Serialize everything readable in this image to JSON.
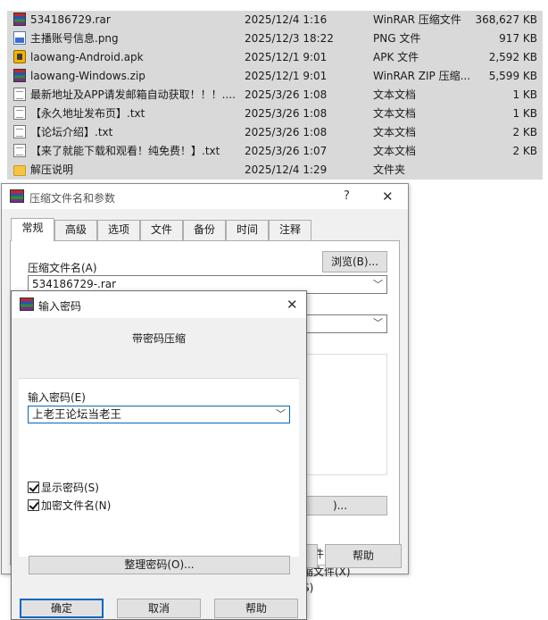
{
  "file_list": {
    "rows": [
      {
        "icon": "rar-archive-icon",
        "name": "534186729.rar",
        "date": "2025/12/4 1:16",
        "type": "WinRAR 压缩文件",
        "size": "368,627 KB"
      },
      {
        "icon": "png-image-icon",
        "name": "主播账号信息.png",
        "date": "2025/12/3 18:22",
        "type": "PNG 文件",
        "size": "917 KB"
      },
      {
        "icon": "apk-file-icon",
        "name": "laowang-Android.apk",
        "date": "2025/12/1 9:01",
        "type": "APK 文件",
        "size": "2,592 KB"
      },
      {
        "icon": "zip-archive-icon",
        "name": "laowang-Windows.zip",
        "date": "2025/12/1 9:01",
        "type": "WinRAR ZIP 压缩...",
        "size": "5,599 KB"
      },
      {
        "icon": "text-file-icon",
        "name": "最新地址及APP请发邮箱自动获取！！！....",
        "date": "2025/3/26 1:08",
        "type": "文本文档",
        "size": "1 KB"
      },
      {
        "icon": "text-file-icon",
        "name": "【永久地址发布页】.txt",
        "date": "2025/3/26 1:08",
        "type": "文本文档",
        "size": "1 KB"
      },
      {
        "icon": "text-file-icon",
        "name": "【论坛介绍】.txt",
        "date": "2025/3/26 1:08",
        "type": "文本文档",
        "size": "2 KB"
      },
      {
        "icon": "text-file-icon",
        "name": "【来了就能下载和观看！纯免费！】.txt",
        "date": "2025/3/26 1:07",
        "type": "文本文档",
        "size": "2 KB"
      },
      {
        "icon": "folder-icon",
        "name": "解压说明",
        "date": "2025/12/4 1:29",
        "type": "文件夹",
        "size": ""
      }
    ]
  },
  "archive_dialog": {
    "title": "压缩文件名和参数",
    "help_glyph": "?",
    "close_glyph": "✕",
    "tabs": [
      "常规",
      "高级",
      "选项",
      "文件",
      "备份",
      "时间",
      "注释"
    ],
    "archive_name_label": "压缩文件名(A)",
    "browse_label": "浏览(B)...",
    "archive_name_value": "534186729-.rar",
    "partial_option_1": "文件(D)",
    "partial_option_2": "缩文件(X)",
    "partial_option_3": "S)",
    "partial_button": ")...",
    "help_label": "帮助"
  },
  "password_dialog": {
    "title": "输入密码",
    "close_glyph": "✕",
    "heading": "带密码压缩",
    "input_label": "输入密码(E)",
    "password_value": "上老王论坛当老王",
    "show_password_label": "显示密码(S)",
    "show_password_checked": true,
    "encrypt_filenames_label": "加密文件名(N)",
    "encrypt_filenames_checked": true,
    "organize_label": "整理密码(O)...",
    "ok_label": "确定",
    "cancel_label": "取消",
    "help_label": "帮助"
  },
  "colors": {
    "list_selection": "#d9d9d9",
    "dialog_bg": "#f0f0f0",
    "accent_border": "#0067c0"
  }
}
